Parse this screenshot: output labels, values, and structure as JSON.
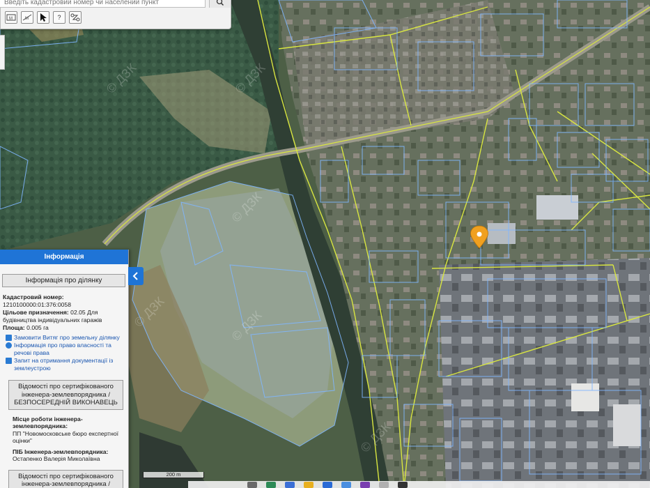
{
  "search": {
    "placeholder": "Введіть кадастровий номер чи населений пункт"
  },
  "toolbar": {
    "tools": [
      {
        "icon": "ruler-area-icon"
      },
      {
        "icon": "ruler-distance-icon"
      },
      {
        "icon": "pointer-icon"
      },
      {
        "icon": "help-icon",
        "label": "?"
      },
      {
        "icon": "route-icon"
      }
    ]
  },
  "info_panel": {
    "header": "Інформація",
    "subtitle": "Інформація про ділянку",
    "cadastral_label": "Кадастровий номер:",
    "cadastral_number": "1210100000:01:376:0058",
    "purpose_label": "Цільове призначення:",
    "purpose_value": "02.05 Для будівництва індивідуальних гаражів",
    "area_label": "Площа:",
    "area_value": "0.005 га",
    "links": [
      {
        "icon": "document-icon",
        "text": "Замовити Витяг про земельну ділянку",
        "color": "#2a7bd3"
      },
      {
        "icon": "info-icon",
        "text": "Інформація про право власності та речові права",
        "color": "#2a7bd3"
      },
      {
        "icon": "request-icon",
        "text": "Запит на отримання документації із землеустрою",
        "color": "#2a7bd3"
      }
    ],
    "engineer_button": "Відомості про сертифікованого інженера-землевпорядника / БЕЗПОСЕРЕДНІЙ ВИКОНАВЕЦЬ",
    "workplace_label": "Місце роботи інженера-землевпорядника:",
    "workplace_value": "ПП \"Новомосковське бюро експертної оцінки\"",
    "name_label": "ПІБ Інженера-землевпорядника:",
    "name_value": "Остапенко Валерія Миколаївна",
    "engineer_button2": "Відомості про сертифікованого інженера-землевпорядника /"
  },
  "map": {
    "watermark": "© ДЗК",
    "scale_label": "200 m",
    "marker_color": "#f0a020",
    "boundary_yellow": "#d9e640",
    "boundary_blue": "#7fb6ff"
  },
  "colors": {
    "accent": "#1f74d6",
    "panel_bg": "#f5f5f5"
  }
}
